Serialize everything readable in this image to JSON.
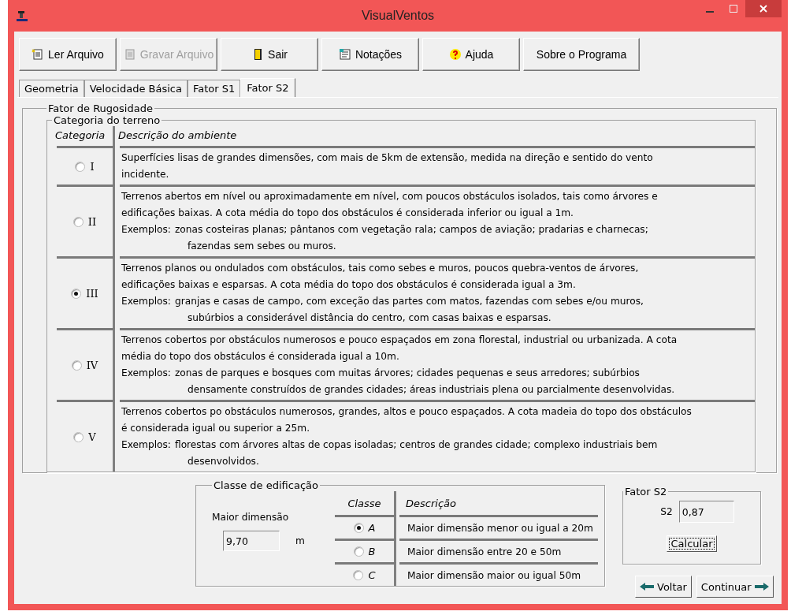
{
  "window": {
    "title": "VisualVentos"
  },
  "toolbar": [
    {
      "label": "Ler Arquivo",
      "kind": "open",
      "disabled": false
    },
    {
      "label": "Gravar Arquivo",
      "kind": "save",
      "disabled": true
    },
    {
      "label": "Sair",
      "kind": "exit",
      "disabled": false
    },
    {
      "label": "Notações",
      "kind": "notes",
      "disabled": false
    },
    {
      "label": "Ajuda",
      "kind": "help",
      "disabled": false
    },
    {
      "label": "Sobre o Programa",
      "kind": "plain",
      "disabled": false
    }
  ],
  "tabs": [
    {
      "label": "Geometria",
      "selected": false
    },
    {
      "label": "Velocidade Básica",
      "selected": false
    },
    {
      "label": "Fator S1",
      "selected": false
    },
    {
      "label": "Fator S2",
      "selected": true
    }
  ],
  "roughness": {
    "title": "Fator de Rugosidade",
    "terrain": {
      "title": "Categoria do terreno",
      "columns": [
        "Categoria",
        "Descrição do ambiente"
      ],
      "rows": [
        {
          "label": "I",
          "selected": false,
          "lines": [
            "Superfícies lisas de grandes dimensões, com mais de 5km de extensão, medida na direção e sentido do vento",
            "incidente."
          ]
        },
        {
          "label": "II",
          "selected": false,
          "lines": [
            "Terrenos abertos em nível ou aproximadamente em nível, com poucos obstáculos isolados, tais como árvores e",
            "edificações baixas. A cota média do topo dos obstáculos é considerada inferior ou igual a 1m."
          ],
          "examples": {
            "label": "Exemplos:",
            "lines": [
              "zonas costeiras planas; pântanos com vegetação rala; campos de aviação; pradarias e charnecas;",
              "fazendas sem sebes ou muros."
            ]
          }
        },
        {
          "label": "III",
          "selected": true,
          "lines": [
            "Terrenos planos ou ondulados com obstáculos, tais como sebes e muros, poucos quebra-ventos de árvores,",
            "edificações baixas e esparsas. A cota média do topo dos obstáculos é considerada igual a 3m."
          ],
          "examples": {
            "label": "Exemplos:",
            "lines": [
              "granjas e casas de campo, com exceção das partes com matos, fazendas com sebes e/ou muros,",
              "subúrbios a considerável distância do centro, com casas baixas e esparsas."
            ]
          }
        },
        {
          "label": "IV",
          "selected": false,
          "lines": [
            "Terrenos cobertos por obstáculos numerosos e pouco espaçados em zona florestal, industrial ou urbanizada. A cota",
            "média do topo dos obstáculos é considerada igual a 10m."
          ],
          "examples": {
            "label": "Exemplos:",
            "lines": [
              "zonas de parques e bosques com muitas árvores; cidades pequenas e seus arredores; subúrbios",
              "densamente construídos de grandes cidades; áreas industriais plena ou parcialmente desenvolvidas."
            ]
          }
        },
        {
          "label": "V",
          "selected": false,
          "lines": [
            "Terrenos cobertos po obstáculos numerosos, grandes, altos e pouco espaçados. A cota madeia do topo dos obstáculos",
            "é considerada igual ou superior a 25m."
          ],
          "examples": {
            "label": "Exemplos:",
            "lines": [
              "florestas com árvores altas de copas isoladas; centros de grandes cidade; complexo industriais bem",
              "desenvolvidos."
            ]
          }
        }
      ]
    }
  },
  "building_class": {
    "title": "Classe de edificação",
    "dimension_label": "Maior dimensão",
    "dimension_value": "9,70",
    "unit": "m",
    "columns": [
      "Classe",
      "Descrição"
    ],
    "rows": [
      {
        "label": "A",
        "selected": true,
        "description": "Maior dimensão menor ou igual a 20m"
      },
      {
        "label": "B",
        "selected": false,
        "description": "Maior dimensão entre 20 e 50m"
      },
      {
        "label": "C",
        "selected": false,
        "description": "Maior dimensão maior ou igual 50m"
      }
    ]
  },
  "factor": {
    "title": "Fator S2",
    "label": "S2",
    "value": "0,87",
    "button": "Calcular"
  },
  "nav": [
    {
      "label": "Voltar",
      "kind": "back"
    },
    {
      "label": "Continuar",
      "kind": "forward"
    }
  ]
}
